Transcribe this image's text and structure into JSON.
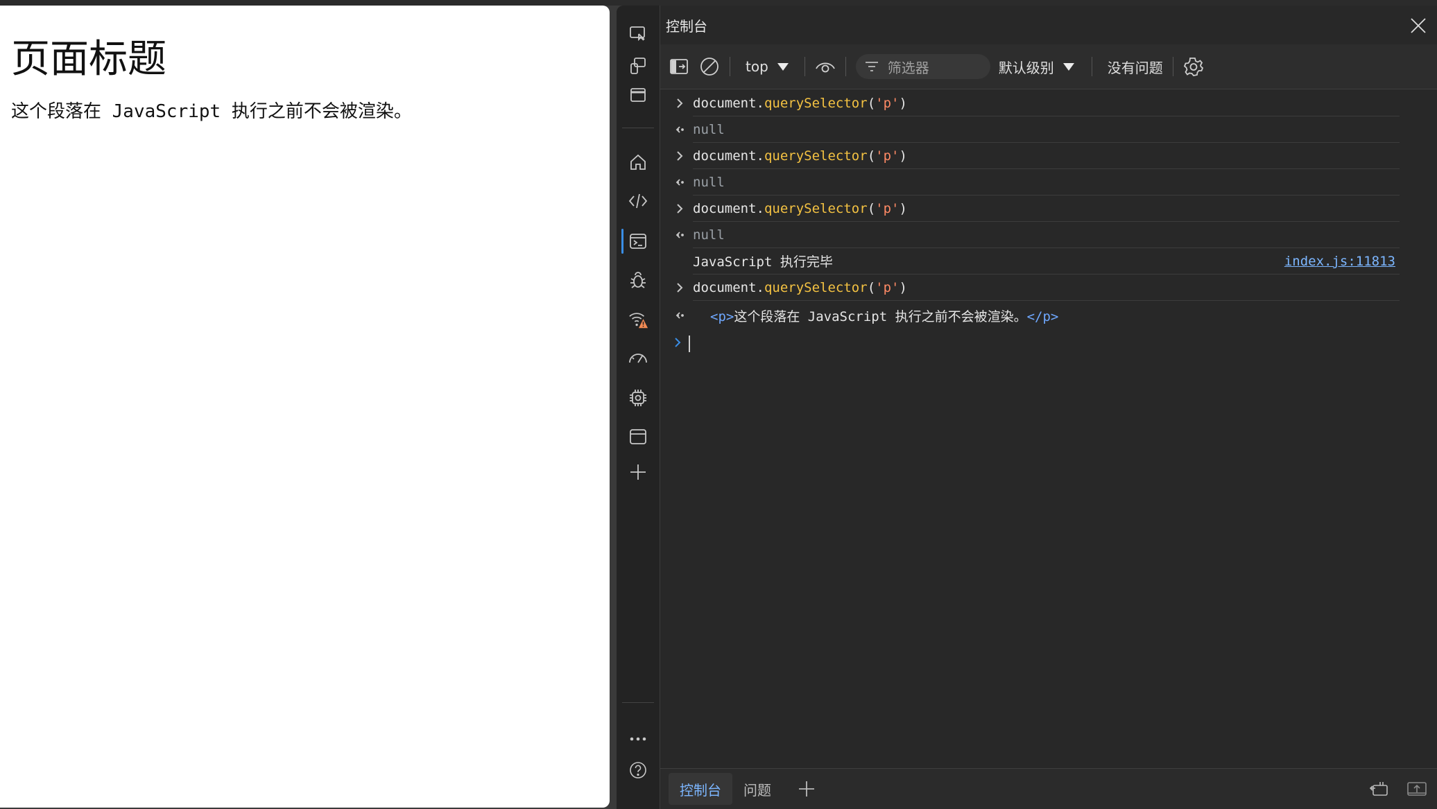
{
  "page": {
    "heading": "页面标题",
    "paragraph": "这个段落在 JavaScript 执行之前不会被渲染。"
  },
  "devtools": {
    "title": "控制台",
    "toolbar": {
      "context": "top",
      "filter_placeholder": "筛选器",
      "level": "默认级别",
      "issues": "没有问题"
    },
    "console": {
      "inputs": {
        "obj": "document",
        "dot": ".",
        "method": "querySelector",
        "open": "(",
        "arg": "'p'",
        "close": ")"
      },
      "null_value": "null",
      "log_message": "JavaScript 执行完毕",
      "log_source": "index.js:11813",
      "result": {
        "open_tag": "<p>",
        "text": "这个段落在 JavaScript 执行之前不会被渲染。",
        "close_tag": "</p>"
      }
    },
    "bottom_tabs": [
      "控制台",
      "问题"
    ]
  }
}
